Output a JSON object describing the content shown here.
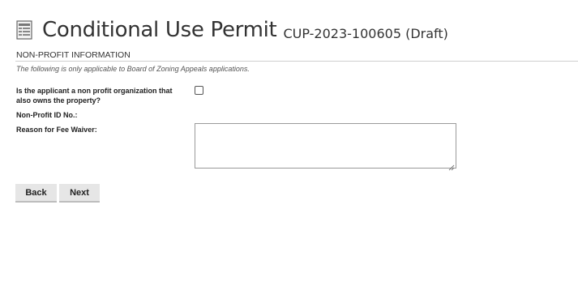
{
  "header": {
    "icon": "document-icon",
    "title": "Conditional Use Permit",
    "record_id": "CUP-2023-100605 (Draft)"
  },
  "section": {
    "title": "NON-PROFIT INFORMATION",
    "instruction": "The following is only applicable to Board of Zoning Appeals applications."
  },
  "fields": {
    "nonprofit_owner": {
      "label": "Is the applicant a non profit organization that also owns the property?",
      "checked": false
    },
    "nonprofit_id": {
      "label": "Non-Profit ID No.:"
    },
    "fee_waiver_reason": {
      "label": "Reason for Fee Waiver:",
      "value": ""
    }
  },
  "buttons": {
    "back_label": "Back",
    "next_label": "Next"
  }
}
